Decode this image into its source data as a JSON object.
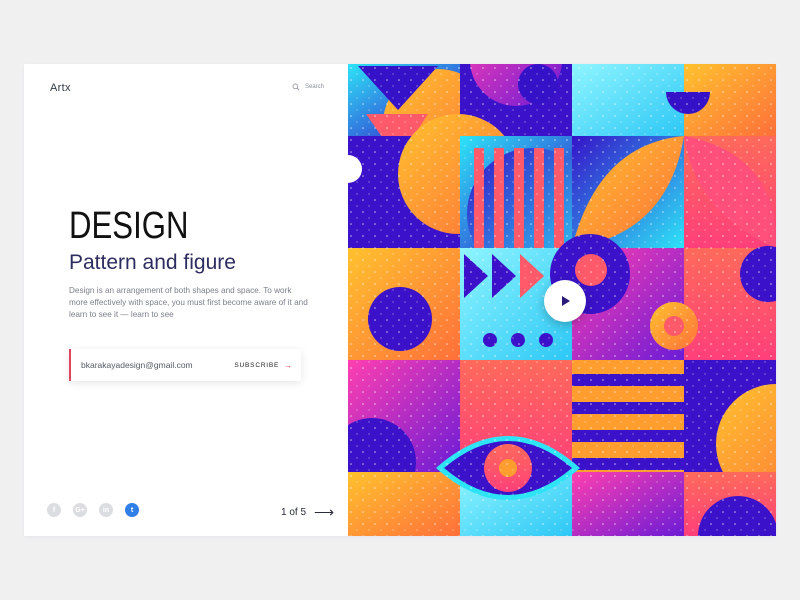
{
  "app": {
    "logo": "Artx"
  },
  "search": {
    "label": "Search"
  },
  "hero": {
    "title": "DESIGN",
    "subtitle": "Pattern and figure",
    "description": "Design is an arrangement of both shapes and space. To work more effectively with space, you must first become aware of it and learn to see it — learn to see"
  },
  "subscribe": {
    "email": "bkarakayadesign@gmail.com",
    "button_label": "SUBSCRIBE"
  },
  "social": [
    {
      "icon": "facebook-icon",
      "glyph": "f"
    },
    {
      "icon": "google-plus-icon",
      "glyph": "G+"
    },
    {
      "icon": "linkedin-icon",
      "glyph": "in"
    },
    {
      "icon": "twitter-icon",
      "glyph": "t"
    }
  ],
  "pager": {
    "text": "1 of 5"
  },
  "colors": {
    "accent": "#e0455f",
    "title": "#2e2d5f",
    "twitter": "#2f7fe6",
    "purple": "#3b12c9",
    "cyan": "#2de4f7",
    "orange": "#ff9e2e",
    "pink": "#ff3fb0",
    "coral": "#ff5a6a"
  }
}
